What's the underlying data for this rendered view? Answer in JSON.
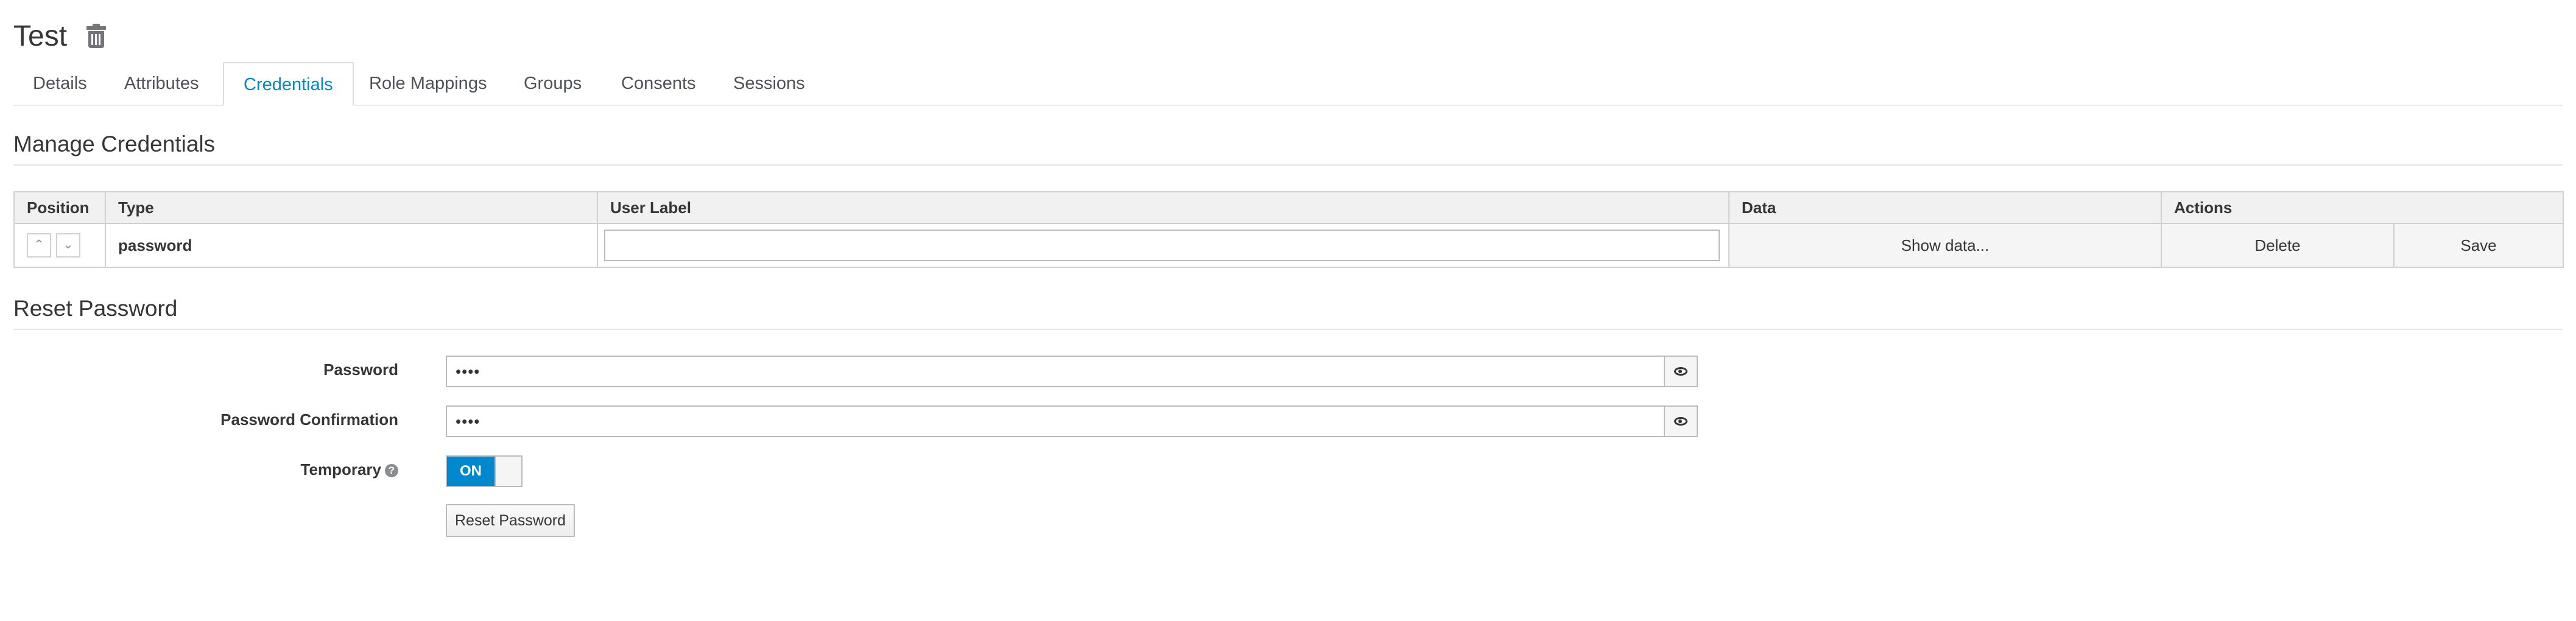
{
  "header": {
    "title": "Test",
    "delete_icon": "trash-icon"
  },
  "tabs": [
    {
      "label": "Details",
      "active": false
    },
    {
      "label": "Attributes",
      "active": false
    },
    {
      "label": "Credentials",
      "active": true
    },
    {
      "label": "Role Mappings",
      "active": false
    },
    {
      "label": "Groups",
      "active": false
    },
    {
      "label": "Consents",
      "active": false
    },
    {
      "label": "Sessions",
      "active": false
    }
  ],
  "manage": {
    "title": "Manage Credentials",
    "columns": {
      "position": "Position",
      "type": "Type",
      "user_label": "User Label",
      "data": "Data",
      "actions": "Actions"
    },
    "row": {
      "up_icon": "chevron-up-icon",
      "down_icon": "chevron-down-icon",
      "type": "password",
      "user_label_value": "",
      "show_data": "Show data...",
      "delete": "Delete",
      "save": "Save"
    }
  },
  "reset": {
    "title": "Reset Password",
    "password_label": "Password",
    "password_value": "••••",
    "confirm_label": "Password Confirmation",
    "confirm_value": "••••",
    "temporary_label": "Temporary",
    "help_icon": "?",
    "toggle_label": "ON",
    "toggle_on": true,
    "button": "Reset Password"
  },
  "colors": {
    "accent": "#0088ce",
    "text": "#363636",
    "border": "#d1d1d1"
  }
}
